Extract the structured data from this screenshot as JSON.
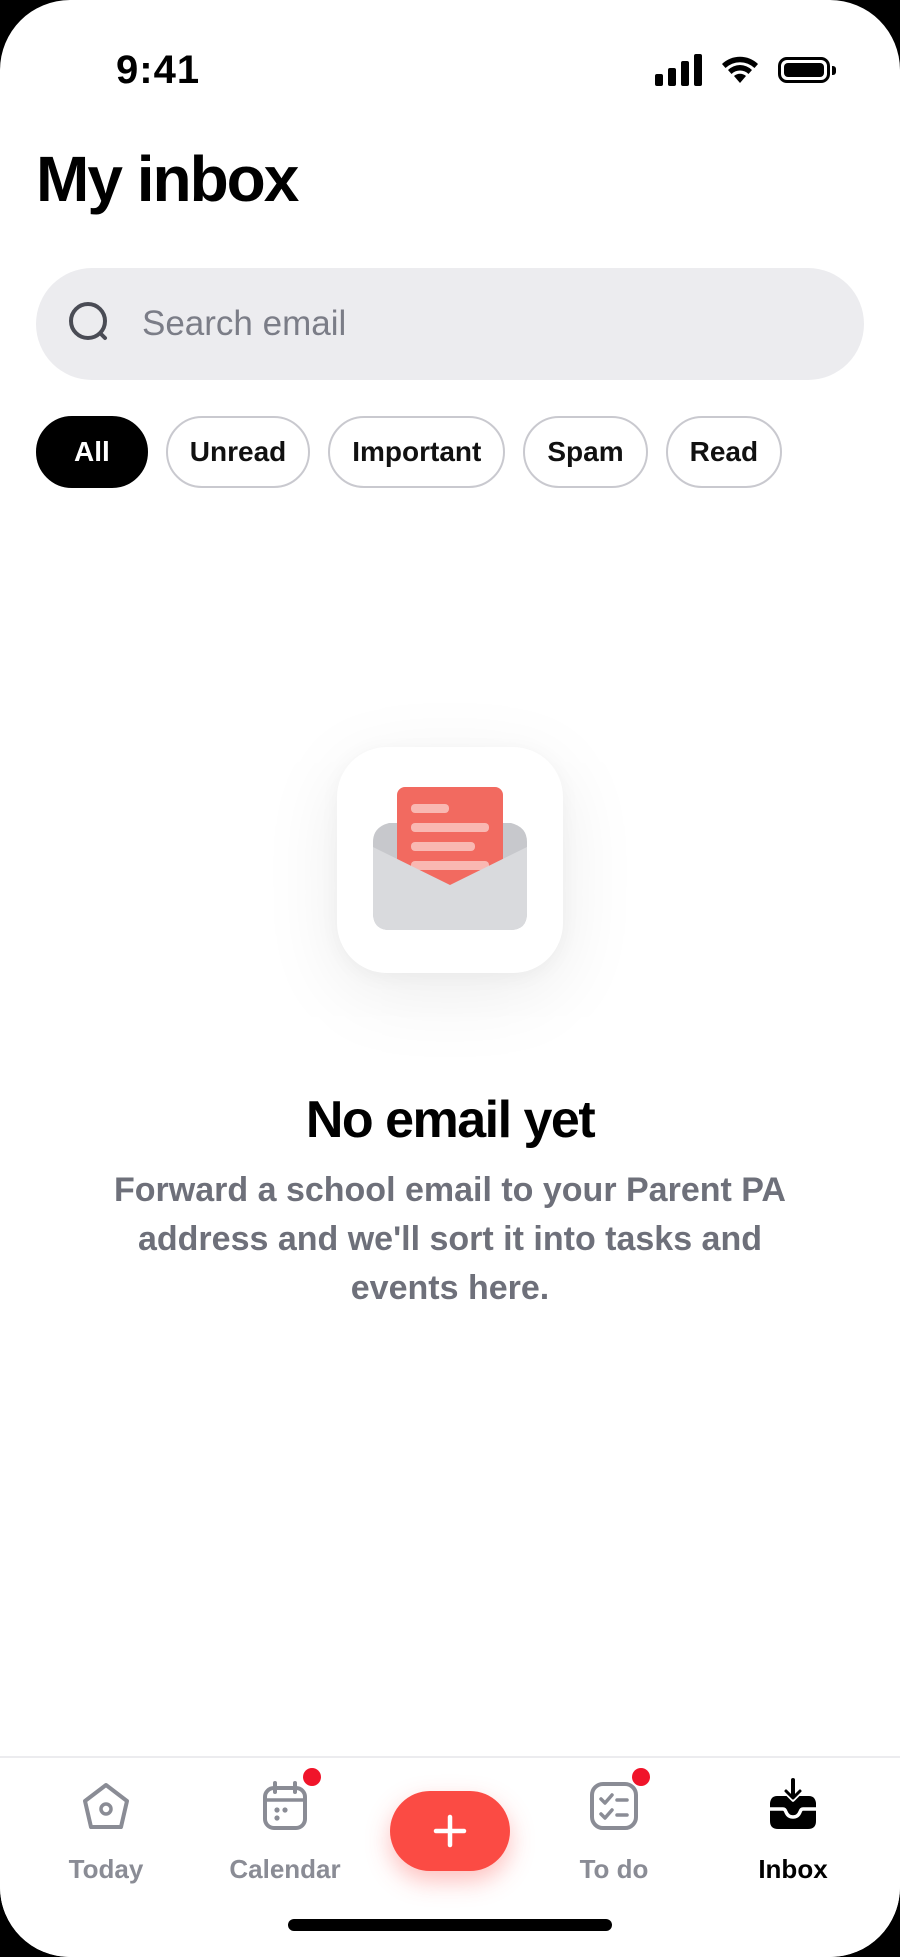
{
  "status_bar": {
    "time": "9:41"
  },
  "header": {
    "title": "My inbox"
  },
  "search": {
    "placeholder": "Search email"
  },
  "filters": [
    {
      "label": "All",
      "active": true
    },
    {
      "label": "Unread",
      "active": false
    },
    {
      "label": "Important",
      "active": false
    },
    {
      "label": "Spam",
      "active": false
    },
    {
      "label": "Read",
      "active": false
    }
  ],
  "empty_state": {
    "icon": "open-envelope-icon",
    "title": "No email yet",
    "message": "Forward a school email to your Parent PA address and we'll sort it into tasks and events here."
  },
  "tab_bar": {
    "items": [
      {
        "label": "Today",
        "icon": "home-icon",
        "active": false,
        "badge": false
      },
      {
        "label": "Calendar",
        "icon": "calendar-icon",
        "active": false,
        "badge": true
      },
      {
        "label": "To do",
        "icon": "checklist-icon",
        "active": false,
        "badge": true
      },
      {
        "label": "Inbox",
        "icon": "inbox-icon",
        "active": true,
        "badge": false
      }
    ],
    "fab_icon": "plus-icon"
  },
  "colors": {
    "accent": "#fb4b44",
    "badge": "#f0142a",
    "chip_active_bg": "#000000",
    "search_bg": "#ececef"
  }
}
